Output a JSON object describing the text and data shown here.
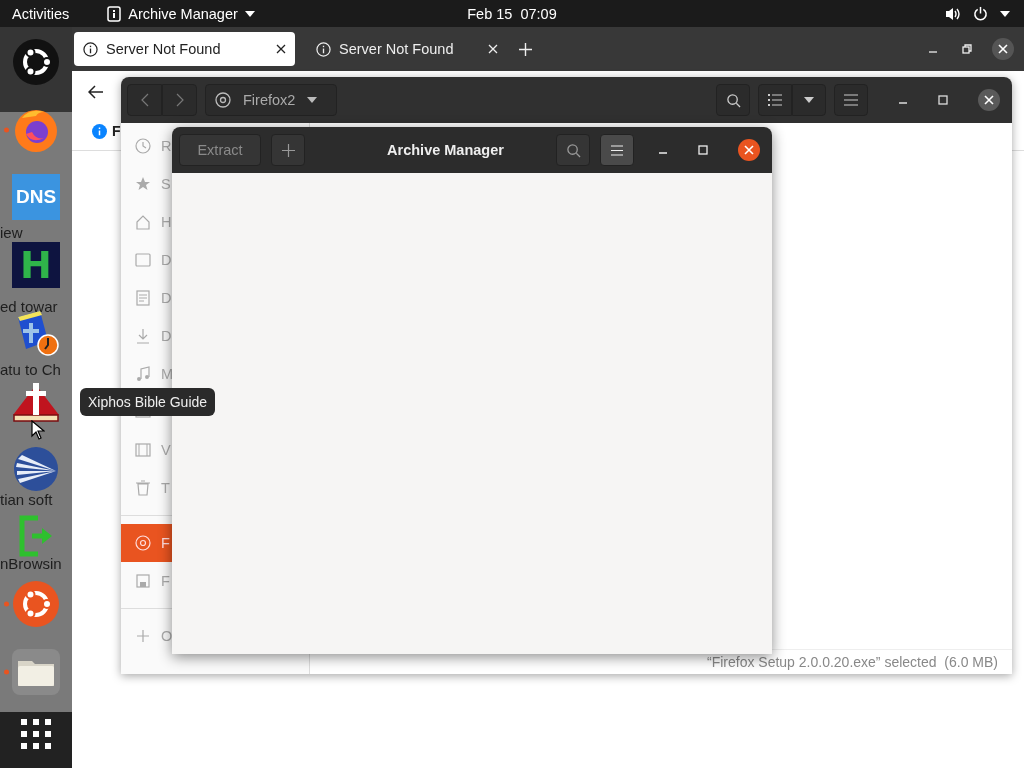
{
  "top_bar": {
    "activities": "Activities",
    "app_menu": "Archive Manager",
    "clock": "Feb 15  07:09"
  },
  "dock": [
    {
      "kind": "ubuntu-dark",
      "running": false
    },
    {
      "kind": "firefox",
      "running": true
    },
    {
      "kind": "tile-blue",
      "text": "DNS",
      "running": false
    },
    {
      "kind": "tile-navy",
      "text": "H",
      "running": false
    },
    {
      "kind": "blue-book",
      "running": false
    },
    {
      "kind": "red-book",
      "running": false
    },
    {
      "kind": "fan",
      "running": false
    },
    {
      "kind": "bracket",
      "running": false
    },
    {
      "kind": "ubuntu-orange",
      "running": true
    },
    {
      "kind": "folder",
      "running": true
    },
    {
      "kind": "apps",
      "running": false
    }
  ],
  "dock_tooltip": "Xiphos Bible Guide",
  "page_behind_dock": [
    "iew",
    "ed towar",
    "atu to Ch",
    "tian soft",
    "nBrowsin"
  ],
  "browser": {
    "tabs": [
      {
        "title": "Server Not Found",
        "selected": true
      },
      {
        "title": "Server Not Found",
        "selected": false
      }
    ],
    "info_bar_text": "F"
  },
  "files_window": {
    "location": "Firefox2",
    "sidebar": [
      {
        "items": [
          {
            "label": "R",
            "selected": false
          },
          {
            "label": "S",
            "selected": false
          },
          {
            "label": "H",
            "selected": false
          },
          {
            "label": "D",
            "selected": false
          },
          {
            "label": "D",
            "selected": false
          },
          {
            "label": "D",
            "selected": false
          },
          {
            "label": "M",
            "selected": false
          },
          {
            "selected": false
          },
          {
            "label": "V",
            "selected": false
          },
          {
            "label": "T",
            "selected": false
          }
        ]
      },
      {
        "items": [
          {
            "label": "F",
            "selected": true
          },
          {
            "label": "F",
            "selected": false
          }
        ]
      },
      {
        "items": [
          {
            "label": "O",
            "selected": false
          }
        ]
      }
    ],
    "status": "“Firefox Setup 2.0.0.20.exe” selected  (6.0 MB)"
  },
  "archive_window": {
    "title": "Archive Manager",
    "extract_button": {
      "label": "Extract",
      "disabled": true
    }
  }
}
